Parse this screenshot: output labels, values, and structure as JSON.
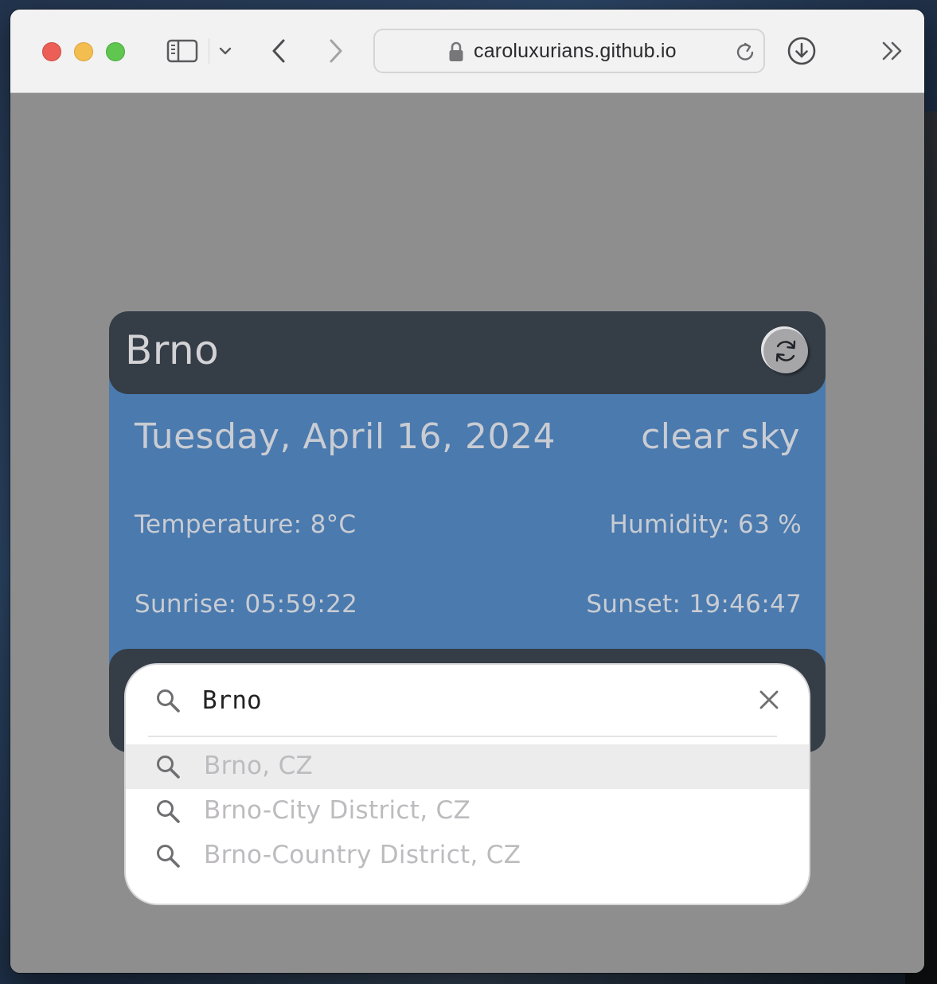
{
  "browser": {
    "url": "caroluxurians.github.io",
    "icons": {
      "sidebar": "sidebar-icon",
      "back": "chevron-left-icon",
      "forward": "chevron-right-icon",
      "lock": "lock-icon",
      "reload": "reload-icon",
      "download": "download-icon",
      "more": "double-chevron-right-icon"
    }
  },
  "weather": {
    "city": "Brno",
    "date": "Tuesday, April 16, 2024",
    "condition": "clear sky",
    "temperature": "Temperature: 8°C",
    "humidity": "Humidity: 63 %",
    "sunrise": "Sunrise: 05:59:22",
    "sunset": "Sunset: 19:46:47"
  },
  "search": {
    "value": "Brno",
    "suggestions": [
      "Brno, CZ",
      "Brno-City District, CZ",
      "Brno-Country District, CZ"
    ]
  },
  "colors": {
    "header_bg": "#353d47",
    "body_bg": "#4a7aae",
    "page_bg": "#8f8e8f",
    "text_light": "#c9ccd3",
    "suggestion_text": "#bdbbbe"
  }
}
